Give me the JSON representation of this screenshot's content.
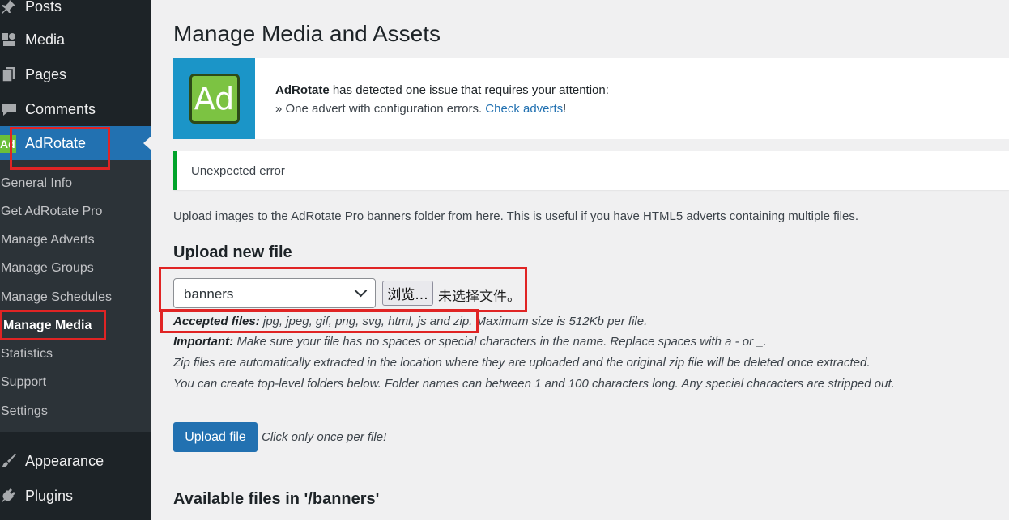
{
  "sidebar": {
    "top_items": [
      {
        "label": "Posts",
        "icon": "pin-icon"
      },
      {
        "label": "Media",
        "icon": "media-icon"
      },
      {
        "label": "Pages",
        "icon": "pages-icon"
      },
      {
        "label": "Comments",
        "icon": "comments-icon"
      },
      {
        "label": "AdRotate",
        "icon": "adrotate-icon",
        "badge": "Ad"
      }
    ],
    "submenu": [
      "General Info",
      "Get AdRotate Pro",
      "Manage Adverts",
      "Manage Groups",
      "Manage Schedules",
      "Manage Media",
      "Statistics",
      "Support",
      "Settings"
    ],
    "bottom_items": [
      {
        "label": "Appearance",
        "icon": "brush-icon"
      },
      {
        "label": "Plugins",
        "icon": "plug-icon"
      }
    ]
  },
  "main": {
    "title": "Manage Media and Assets",
    "ad_notice": {
      "logo_text": "Ad",
      "brand": "AdRotate",
      "line1_rest": " has detected one issue that requires your attention:",
      "line2_prefix": "» One advert with configuration errors. ",
      "link": "Check adverts",
      "line2_suffix": "!"
    },
    "error_notice": "Unexpected error",
    "intro": "Upload images to the AdRotate Pro banners folder from here. This is useful if you have HTML5 adverts containing multiple files.",
    "upload_heading": "Upload new file",
    "folder_select": "banners",
    "browse_label": "浏览...",
    "no_file_text": "未选择文件。",
    "help": {
      "accepted_label": "Accepted files:",
      "accepted_rest": " jpg, jpeg, gif, png, svg, html, js and zip. Maximum size is 512Kb per file.",
      "important_label": "Important:",
      "important_rest": " Make sure your file has no spaces or special characters in the name. Replace spaces with a - or _.",
      "zip_note": "Zip files are automatically extracted in the location where they are uploaded and the original zip file will be deleted once extracted.",
      "folder_note": "You can create top-level folders below. Folder names can between 1 and 100 characters long. Any special characters are stripped out."
    },
    "upload_button": "Upload file",
    "click_once": "Click only once per file!",
    "available_heading": "Available files in '/banners'"
  },
  "colors": {
    "admin_blue": "#2271b1",
    "sidebar_bg": "#1d2327",
    "highlight_red": "#e02424",
    "success_green": "#00a32a"
  }
}
